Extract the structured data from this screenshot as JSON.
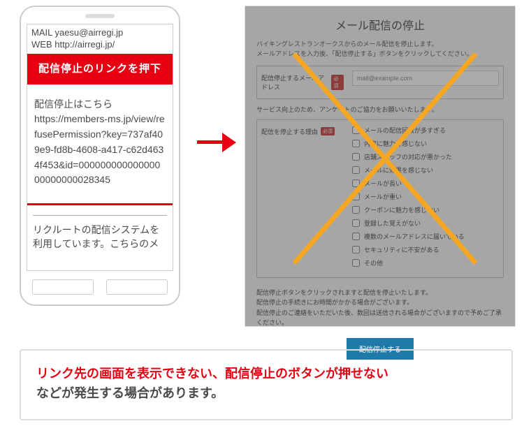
{
  "phone": {
    "mail_top_line1": "MAIL yaesu@airregi.jp",
    "mail_top_line2": "WEB http://airregi.jp/",
    "banner": "配信停止のリンクを押下",
    "body_line1": "配信停止はこちら",
    "body_url": "https://members-ms.jp/view/refusePermission?key=737af409e9-fd8b-4608-a417-c62d4634f453&id=00000000000000000000000028345",
    "below": "リクルートの配信システムを利用しています。こちらのメ"
  },
  "webpage": {
    "title": "メール配信の停止",
    "lead1": "バイキングレストランオークスからのメール配信を停止します。",
    "lead2": "メールアドレスを入力後、「配信停止する」ボタンをクリックしてください。",
    "email_label": "配信停止するメールアドレス",
    "required": "必須",
    "email_placeholder": "mail@example.com",
    "survey_note": "サービス向上のため、アンケートのご協力をお願いいたします。",
    "reason_label": "配信を停止する理由",
    "reasons": [
      "メールの配信回数が多すぎる",
      "内容に魅力を感じない",
      "店舗スタッフの対応が悪かった",
      "メールに効果を感じない",
      "メールが長い",
      "メールが重い",
      "クーポンに魅力を感じない",
      "登録した覚えがない",
      "複数のメールアドレスに届いている",
      "セキュリティに不安がある",
      "その他"
    ],
    "note1": "配信停止ボタンをクリックされますと配信を停止いたします。",
    "note2": "配信停止の手続きにお時間がかかる場合がございます。",
    "note3": "配信停止のご連絡をいただいた後、数回は送信される場合がございますので予めご了承ください。",
    "button": "配信停止する"
  },
  "conclusion": {
    "red": "リンク先の画面を表示できない、配信停止のボタンが押せない",
    "rest": "などが発生する場合があります。"
  }
}
